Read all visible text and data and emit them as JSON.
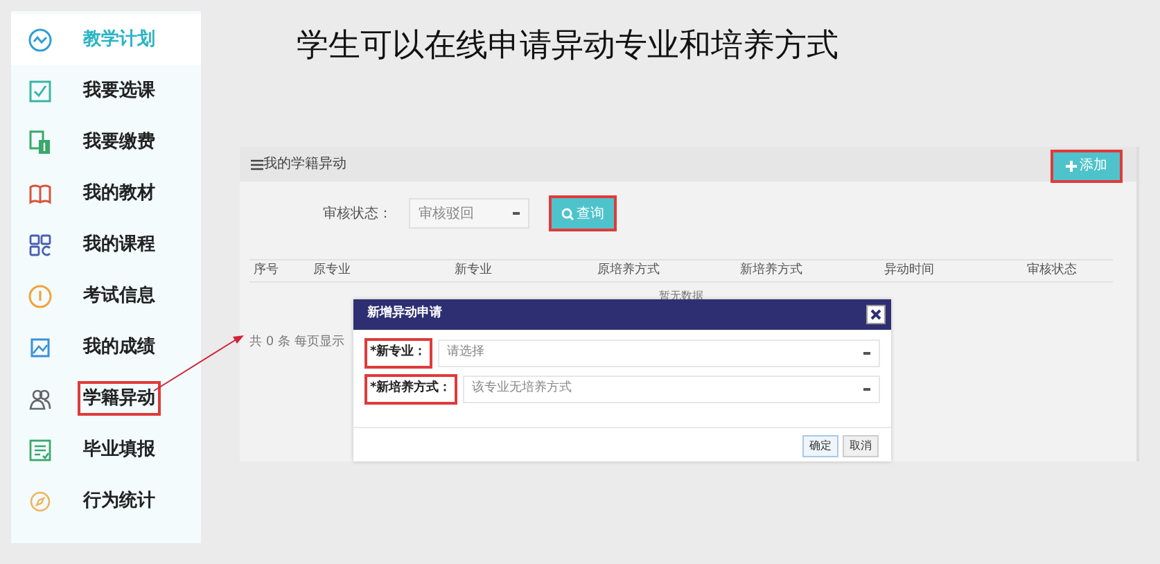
{
  "slide_title": "学生可以在线申请异动专业和培养方式",
  "sidebar": {
    "items": [
      {
        "label": "教学计划",
        "selected": true,
        "highlighted": false
      },
      {
        "label": "我要选课",
        "selected": false,
        "highlighted": false
      },
      {
        "label": "我要缴费",
        "selected": false,
        "highlighted": false
      },
      {
        "label": "我的教材",
        "selected": false,
        "highlighted": false
      },
      {
        "label": "我的课程",
        "selected": false,
        "highlighted": false
      },
      {
        "label": "考试信息",
        "selected": false,
        "highlighted": false
      },
      {
        "label": "我的成绩",
        "selected": false,
        "highlighted": false
      },
      {
        "label": "学籍异动",
        "selected": false,
        "highlighted": true
      },
      {
        "label": "毕业填报",
        "selected": false,
        "highlighted": false
      },
      {
        "label": "行为统计",
        "selected": false,
        "highlighted": false
      }
    ]
  },
  "panel": {
    "title": "我的学籍异动",
    "add_button": {
      "label": "添加",
      "highlighted": true
    },
    "filter": {
      "label": "审核状态：",
      "value": "审核驳回"
    },
    "query_button": {
      "label": "查询",
      "highlighted": true
    },
    "table": {
      "columns": [
        "序号",
        "原专业",
        "新专业",
        "原培养方式",
        "新培养方式",
        "异动时间",
        "审核状态"
      ],
      "empty_text": "暂无数据"
    },
    "pagination": "共 0 条 每页显示"
  },
  "dialog": {
    "title": "新增异动申请",
    "fields": [
      {
        "label": "*新专业：",
        "placeholder": "请选择",
        "highlighted": true
      },
      {
        "label": "*新培养方式：",
        "placeholder": "该专业无培养方式",
        "highlighted": true
      }
    ],
    "buttons": [
      "确定",
      "取消"
    ]
  }
}
